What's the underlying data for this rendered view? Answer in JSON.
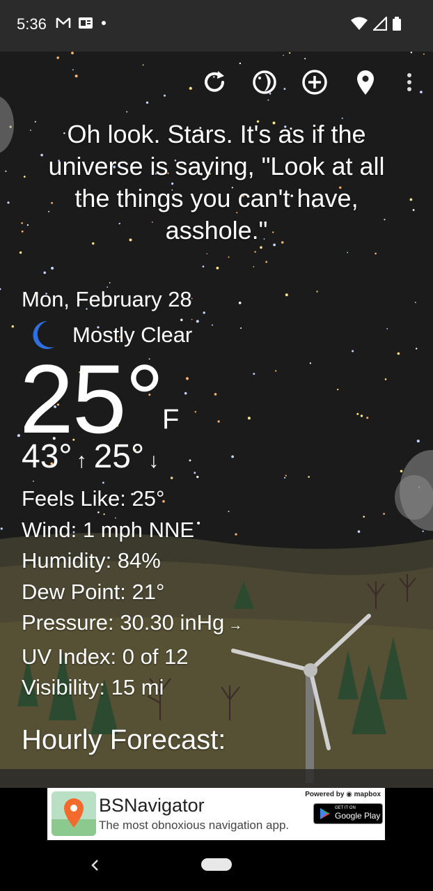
{
  "status_bar": {
    "time": "5:36",
    "left_icons": [
      "gmail-icon",
      "news-icon",
      "dot-icon"
    ],
    "right_icons": [
      "wifi-icon",
      "signal-icon",
      "battery-icon"
    ]
  },
  "toolbar": {
    "buttons": [
      "refresh-icon",
      "theme-icon",
      "add-location-icon",
      "location-pin-icon",
      "more-options-icon"
    ]
  },
  "quote": "Oh look. Stars. It's as if the universe is saying, \"Look at all the things you can't have, asshole.\"",
  "weather": {
    "date": "Mon, February 28",
    "condition": "Mostly Clear",
    "condition_icon": "crescent-moon-icon",
    "temperature": "25°",
    "unit": "F",
    "high": "43°",
    "high_arrow": "↑",
    "low": "25°",
    "low_arrow": "↓",
    "details": {
      "feels_like": "Feels Like:  25°",
      "wind": "Wind:  1 mph NNE",
      "humidity": "Humidity:  84%",
      "dew_point": "Dew Point:  21°",
      "pressure": "Pressure:  30.30 inHg",
      "pressure_trend": "→",
      "uv_index": "UV Index:  0 of 12",
      "visibility": "Visibility:  15 mi"
    }
  },
  "hourly_title": "Hourly Forecast:",
  "ad": {
    "title": "BSNavigator",
    "subtitle": "The most obnoxious navigation app.",
    "powered_by": "Powered by ◉ mapbox",
    "store_small": "GET IT ON",
    "store_big": "Google Play"
  },
  "colors": {
    "sky": "#1b1b1b",
    "hills": "#4b4733",
    "moon": "#2f6fe0",
    "status_bar": "#2b2b2b"
  }
}
